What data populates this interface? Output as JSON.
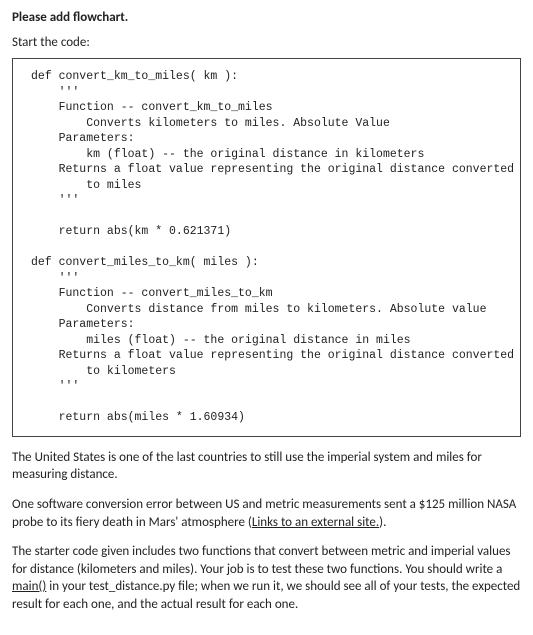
{
  "heading": "Please add flowchart.",
  "intro": "Start the code:",
  "code": "def convert_km_to_miles( km ):\n    '''\n    Function -- convert_km_to_miles\n        Converts kilometers to miles. Absolute Value\n    Parameters:\n        km (float) -- the original distance in kilometers\n    Returns a float value representing the original distance converted\n        to miles\n    '''\n\n    return abs(km * 0.621371)\n\ndef convert_miles_to_km( miles ):\n    '''\n    Function -- convert_miles_to_km\n        Converts distance from miles to kilometers. Absolute value\n    Parameters:\n        miles (float) -- the original distance in miles\n    Returns a float value representing the original distance converted\n        to kilometers\n    '''\n\n    return abs(miles * 1.60934)",
  "para1": "The United States is one of the last countries to still use the imperial system and miles for measuring distance.",
  "para2a": "One software conversion error between US and metric measurements sent a $125 million NASA probe to its fiery death in Mars' atmosphere (",
  "para2link": "Links to an external site.",
  "para2b": ").",
  "para3a": "The starter code given includes two functions that convert between metric and imperial values for distance (kilometers and miles). Your job is to test these two functions.  You should write a ",
  "para3link": "main()",
  "para3b": " in your test_distance.py file; when we run it, we should see all of your tests, the expected result for each one, and the actual result for each one."
}
